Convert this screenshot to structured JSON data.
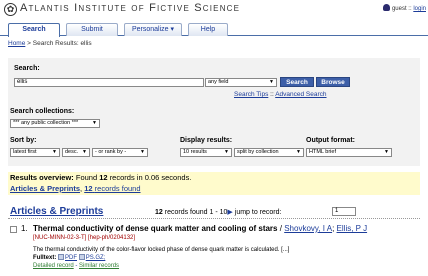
{
  "header": {
    "site_title": "Atlantis Institute of Fictive Science",
    "user_label": "guest ::",
    "login_label": "login"
  },
  "tabs": [
    {
      "label": "Search",
      "active": true
    },
    {
      "label": "Submit",
      "active": false
    },
    {
      "label": "Personalize ▾",
      "active": false
    },
    {
      "label": "Help",
      "active": false
    }
  ],
  "breadcrumb": {
    "home": "Home",
    "rest": "> Search Results: ellis"
  },
  "search": {
    "label": "Search:",
    "query": "ellis",
    "field_select": "any field",
    "search_button": "Search",
    "browse_button": "Browse",
    "tips_link": "Search Tips",
    "separator": "::",
    "advanced_link": "Advanced Search",
    "collections_label": "Search collections:",
    "collections_select": "*** any public collection ***",
    "sort_label": "Sort by:",
    "sort_select": "latest first",
    "order_select": "desc.",
    "rank_select": "- or rank by -",
    "display_label": "Display results:",
    "display_select": "10 results",
    "split_select": "split by collection",
    "format_label": "Output format:",
    "format_select": "HTML brief"
  },
  "overview": {
    "prefix": "Results overview:",
    "found_text_1": "Found",
    "count": "12",
    "found_text_2": "records in 0.06 seconds.",
    "collection_link": "Articles & Preprints",
    "collection_sep": ",",
    "collection_count": "12",
    "collection_found": "records found"
  },
  "results": {
    "section_title": "Articles & Preprints",
    "count": "12",
    "found_label": "records found",
    "range": "1 - 10",
    "jump_label": "jump to record:",
    "jump_value": "1",
    "record": {
      "number": "1.",
      "title": "Thermal conductivity of dense quark matter and cooling of stars",
      "author_sep": "/",
      "author1": "Shovkovy, I A",
      "author_sep2": ";",
      "author2": "Ellis, P J",
      "report_numbers": "[NUC-MINN-02-3-T] [hep-ph/0204132]",
      "abstract": "The thermal conductivity of the color-flavor locked phase of dense quark matter is calculated. [...]",
      "fulltext_label": "Fulltext:",
      "pdf_label": "PDF",
      "psgz_label": "PS.GZ;",
      "detailed_link": "Detailed record",
      "similar_sep": "-",
      "similar_link": "Similar records"
    }
  }
}
